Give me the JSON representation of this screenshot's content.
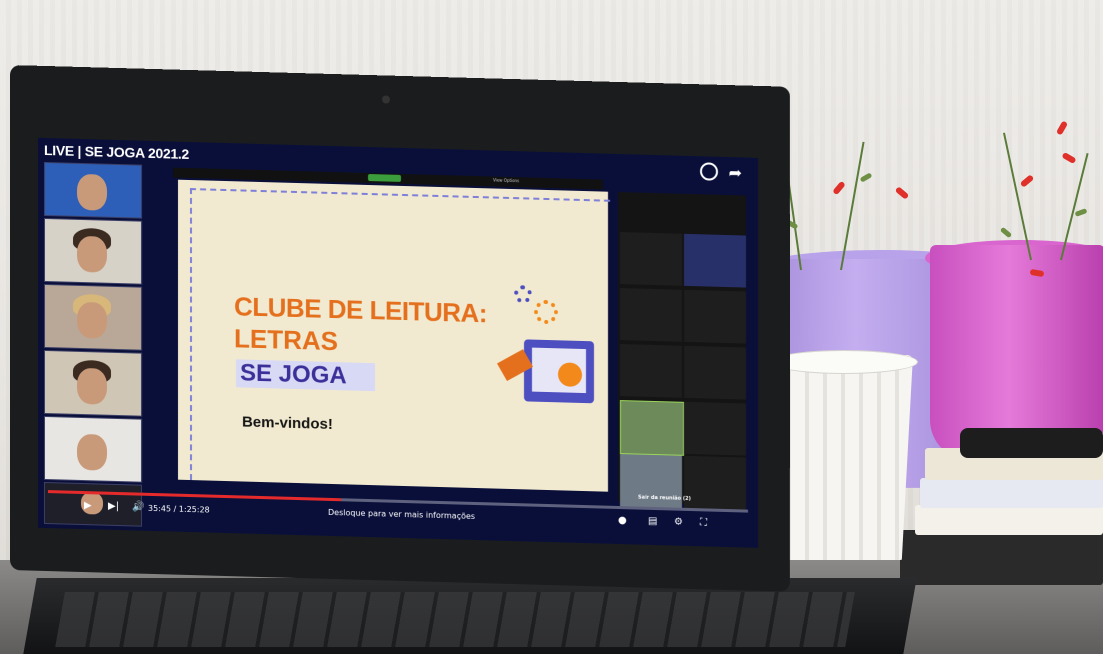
{
  "video": {
    "title": "LIVE | SE JOGA 2021.2",
    "current_time": "35:45",
    "duration": "1:25:28",
    "time_display": "35:45 / 1:25:28",
    "progress": 0.418,
    "info_hint": "Desloque para ver mais informações"
  },
  "slide": {
    "line1": "CLUBE DE LEITURA:",
    "line2": "LETRAS",
    "line3": "SE JOGA",
    "welcome": "Bem-vindos!"
  },
  "zoom": {
    "view_options": "View Options",
    "leave_label": "Sair da reunião (2)"
  },
  "colors": {
    "slide_orange": "#e4701e",
    "slide_purple": "#3b2f9a",
    "progress_red": "#e42a2a"
  }
}
